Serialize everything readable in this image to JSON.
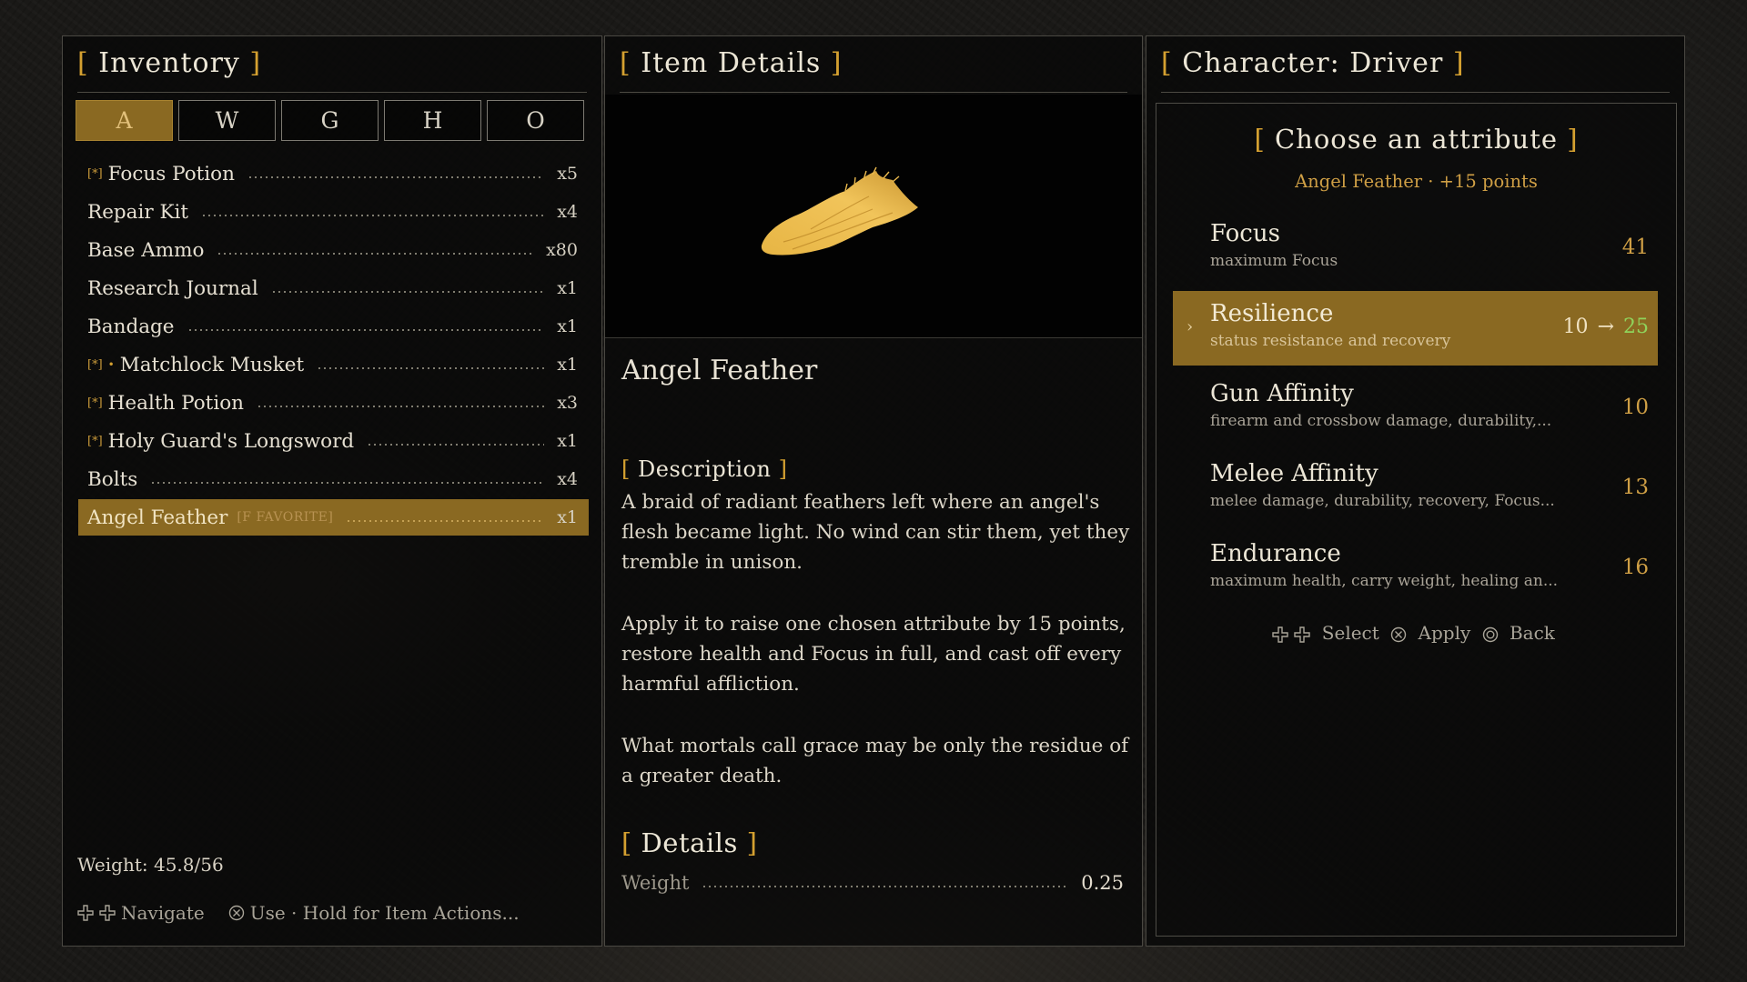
{
  "inventory": {
    "title": "Inventory",
    "tabs": [
      "A",
      "W",
      "G",
      "H",
      "O"
    ],
    "active_tab": 0,
    "items": [
      {
        "name": "Focus Potion",
        "qty": "x5",
        "favorite": true
      },
      {
        "name": "Repair Kit",
        "qty": "x4"
      },
      {
        "name": "Base Ammo",
        "qty": "x80"
      },
      {
        "name": "Research Journal",
        "qty": "x1"
      },
      {
        "name": "Bandage",
        "qty": "x1"
      },
      {
        "name": "Matchlock Musket",
        "qty": "x1",
        "favorite": true,
        "equipped": true
      },
      {
        "name": "Health Potion",
        "qty": "x3",
        "favorite": true
      },
      {
        "name": "Holy Guard's Longsword",
        "qty": "x1",
        "favorite": true
      },
      {
        "name": "Bolts",
        "qty": "x4"
      },
      {
        "name": "Angel Feather",
        "qty": "x1",
        "selected": true,
        "tag": "[F FAVORITE]"
      }
    ],
    "favorite_marker": "[*]",
    "weight_text": "Weight: 45.8/56",
    "hints": {
      "navigate": "Navigate",
      "use": "Use · Hold for Item Actions..."
    }
  },
  "item_details": {
    "title": "Item Details",
    "item_name": "Angel Feather",
    "description_title": "Description",
    "description": [
      "A braid of radiant feathers left where an angel's flesh became light. No wind can stir them, yet they tremble in unison.",
      "Apply it to raise one chosen attribute by 15 points, restore health and Focus in full, and cast off every harmful affliction.",
      "What mortals call grace may be only the residue of a greater death."
    ],
    "details_title": "Details",
    "weight_label": "Weight",
    "weight_value": "0.25",
    "image_icon": "angel-feather-icon"
  },
  "character": {
    "title": "Character: Driver",
    "prompt": "Choose an attribute",
    "subtitle": "Angel Feather · +15 points",
    "attributes": [
      {
        "name": "Focus",
        "desc": "maximum Focus",
        "value": "41"
      },
      {
        "name": "Resilience",
        "desc": "status resistance and recovery",
        "value": "10",
        "arrow": "→",
        "new_value": "25",
        "selected": true
      },
      {
        "name": "Gun Affinity",
        "desc": "firearm and crossbow damage, durability,...",
        "value": "10"
      },
      {
        "name": "Melee Affinity",
        "desc": "melee damage, durability, recovery, Focus...",
        "value": "13"
      },
      {
        "name": "Endurance",
        "desc": "maximum health, carry weight, healing an...",
        "value": "16"
      }
    ],
    "hints": {
      "select": "Select",
      "apply": "Apply",
      "back": "Back"
    }
  },
  "colors": {
    "accent_gold": "#d4a030",
    "selection": "#8a6922",
    "increase_green": "#8fd35b"
  }
}
